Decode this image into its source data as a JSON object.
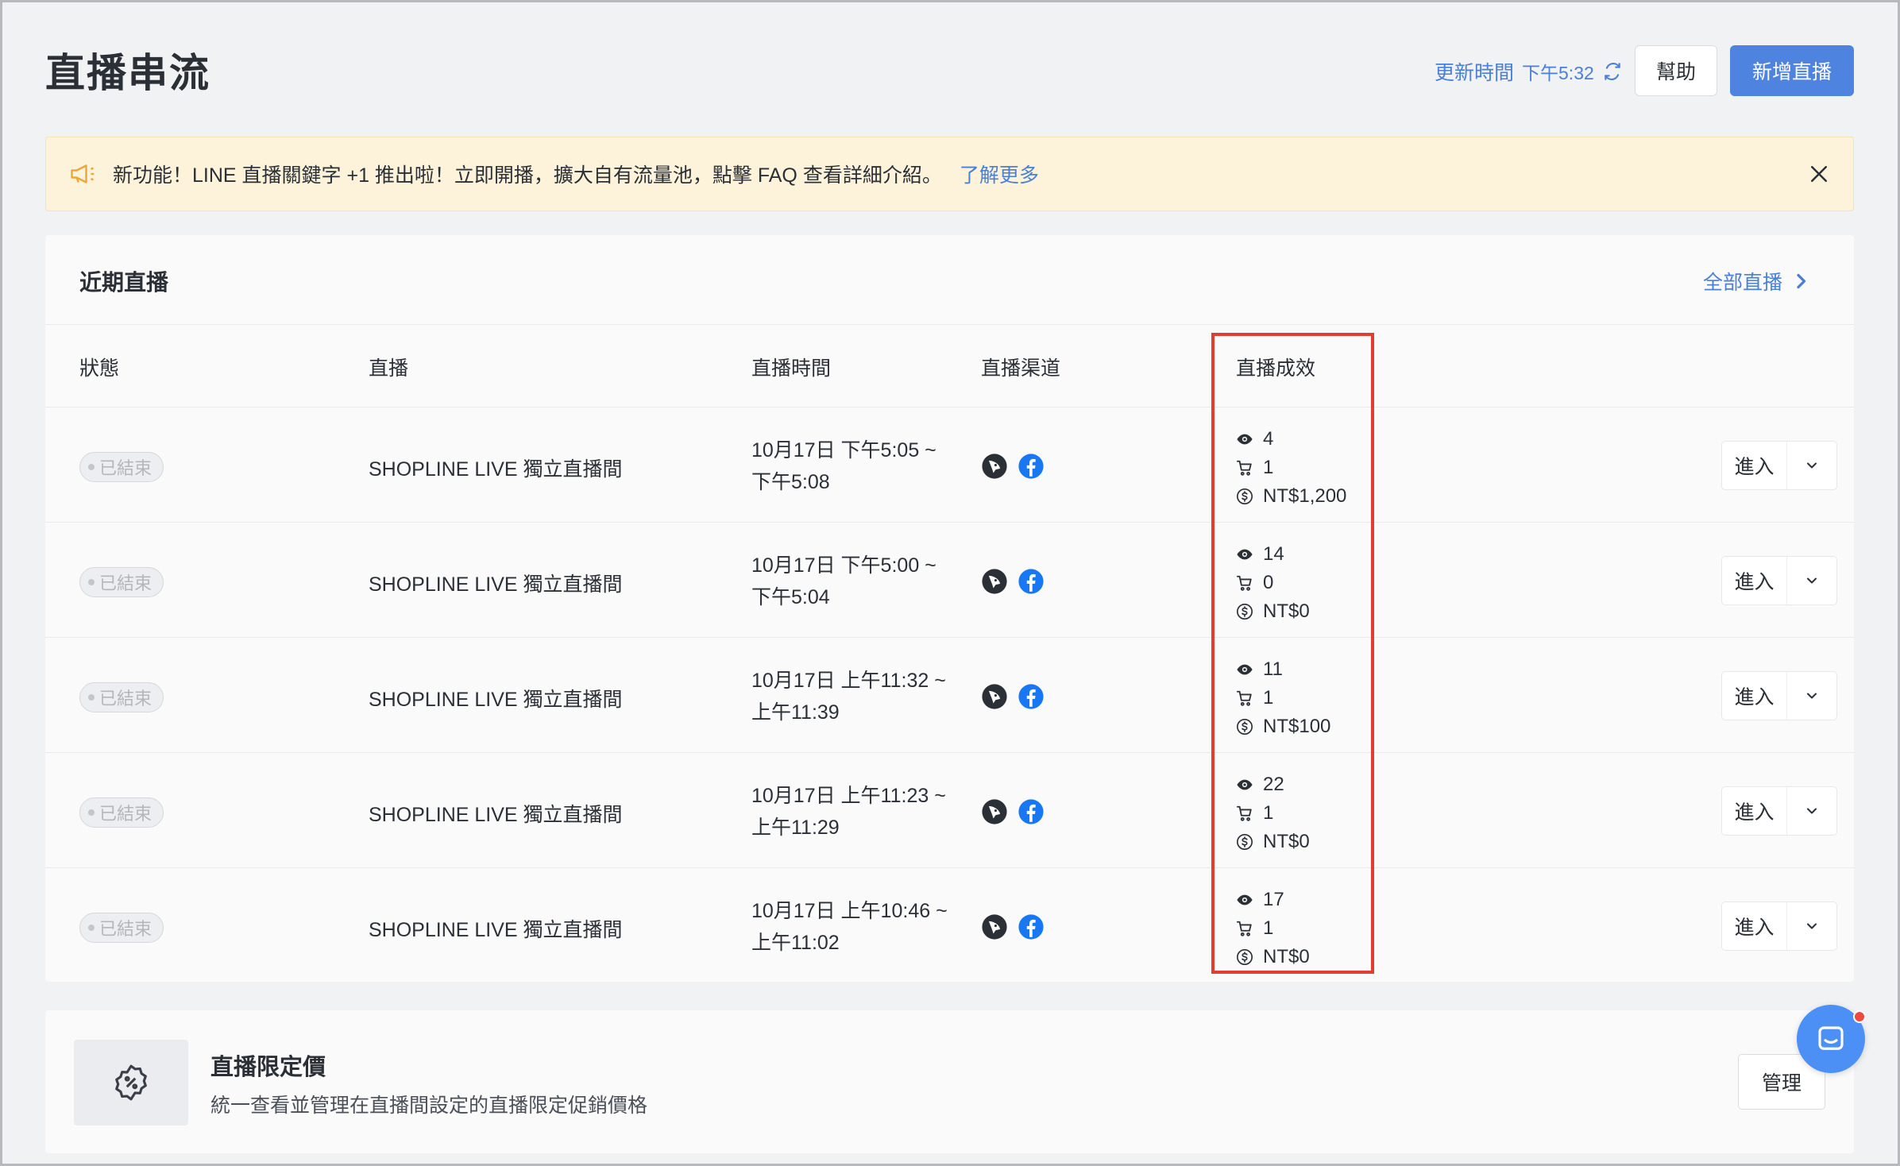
{
  "header": {
    "title": "直播串流",
    "update_label": "更新時間",
    "update_time": "下午5:32",
    "help_label": "幫助",
    "new_label": "新增直播"
  },
  "banner": {
    "text": "新功能！LINE 直播關鍵字 +1 推出啦！立即開播，擴大自有流量池，點擊 FAQ 查看詳細介紹。",
    "link": "了解更多"
  },
  "recent": {
    "title": "近期直播",
    "all_link": "全部直播",
    "columns": {
      "status": "狀態",
      "stream": "直播",
      "time": "直播時間",
      "channel": "直播渠道",
      "performance": "直播成效"
    },
    "rows": [
      {
        "status": "已結束",
        "name": "SHOPLINE LIVE 獨立直播間",
        "time1": "10月17日 下午5:05 ~",
        "time2": "下午5:08",
        "views": "4",
        "orders": "1",
        "revenue": "NT$1,200",
        "enter": "進入"
      },
      {
        "status": "已結束",
        "name": "SHOPLINE LIVE 獨立直播間",
        "time1": "10月17日 下午5:00 ~",
        "time2": "下午5:04",
        "views": "14",
        "orders": "0",
        "revenue": "NT$0",
        "enter": "進入"
      },
      {
        "status": "已結束",
        "name": "SHOPLINE LIVE 獨立直播間",
        "time1": "10月17日 上午11:32 ~",
        "time2": "上午11:39",
        "views": "11",
        "orders": "1",
        "revenue": "NT$100",
        "enter": "進入"
      },
      {
        "status": "已結束",
        "name": "SHOPLINE LIVE 獨立直播間",
        "time1": "10月17日 上午11:23 ~",
        "time2": "上午11:29",
        "views": "22",
        "orders": "1",
        "revenue": "NT$0",
        "enter": "進入"
      },
      {
        "status": "已結束",
        "name": "SHOPLINE LIVE 獨立直播間",
        "time1": "10月17日 上午10:46 ~",
        "time2": "上午11:02",
        "views": "17",
        "orders": "1",
        "revenue": "NT$0",
        "enter": "進入"
      }
    ]
  },
  "promo": {
    "title": "直播限定價",
    "desc": "統一查看並管理在直播間設定的直播限定促銷價格",
    "manage_label": "管理"
  },
  "colors": {
    "accent": "#4f83e0",
    "link": "#4a7fd6",
    "highlight": "#e23d33",
    "banner_bg": "#fdf3da"
  }
}
